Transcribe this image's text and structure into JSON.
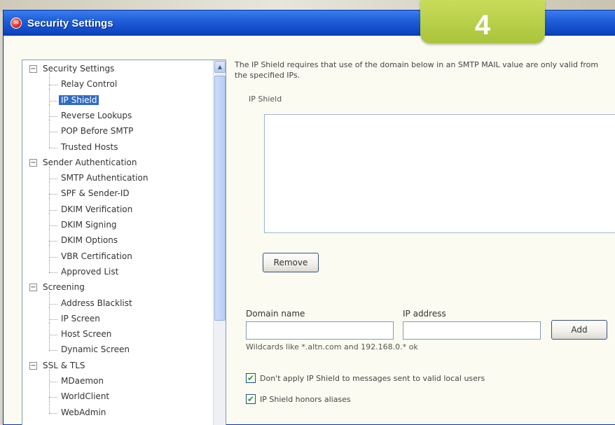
{
  "step_badge": "4",
  "window": {
    "title": "Security Settings",
    "icon": "mdaemon-app-icon"
  },
  "tree": {
    "items": [
      {
        "label": "Security Settings",
        "level": 0,
        "expander": "−"
      },
      {
        "label": "Relay Control",
        "level": 1
      },
      {
        "label": "IP Shield",
        "level": 1,
        "selected": true
      },
      {
        "label": "Reverse Lookups",
        "level": 1
      },
      {
        "label": "POP Before SMTP",
        "level": 1
      },
      {
        "label": "Trusted Hosts",
        "level": 1
      },
      {
        "label": "Sender Authentication",
        "level": 0,
        "expander": "−"
      },
      {
        "label": "SMTP Authentication",
        "level": 1
      },
      {
        "label": "SPF & Sender-ID",
        "level": 1
      },
      {
        "label": "DKIM Verification",
        "level": 1
      },
      {
        "label": "DKIM Signing",
        "level": 1
      },
      {
        "label": "DKIM Options",
        "level": 1
      },
      {
        "label": "VBR Certification",
        "level": 1
      },
      {
        "label": "Approved List",
        "level": 1
      },
      {
        "label": "Screening",
        "level": 0,
        "expander": "−"
      },
      {
        "label": "Address Blacklist",
        "level": 1
      },
      {
        "label": "IP Screen",
        "level": 1
      },
      {
        "label": "Host Screen",
        "level": 1
      },
      {
        "label": "Dynamic Screen",
        "level": 1
      },
      {
        "label": "SSL & TLS",
        "level": 0,
        "expander": "−"
      },
      {
        "label": "MDaemon",
        "level": 1
      },
      {
        "label": "WorldClient",
        "level": 1
      },
      {
        "label": "WebAdmin",
        "level": 1
      }
    ]
  },
  "panel": {
    "description": "The IP Shield requires that use of the domain below in an SMTP MAIL value are only valid from the specified IPs.",
    "group_title": "IP Shield",
    "remove_label": "Remove",
    "domain_label": "Domain name",
    "ip_label": "IP address",
    "domain_value": "",
    "ip_value": "",
    "add_label": "Add",
    "hint": "Wildcards like *.altn.com and 192.168.0.* ok",
    "check_local_users": "Don't apply IP Shield to messages sent to valid local users",
    "check_aliases": "IP Shield honors aliases",
    "check_local_users_checked": true,
    "check_aliases_checked": true
  }
}
